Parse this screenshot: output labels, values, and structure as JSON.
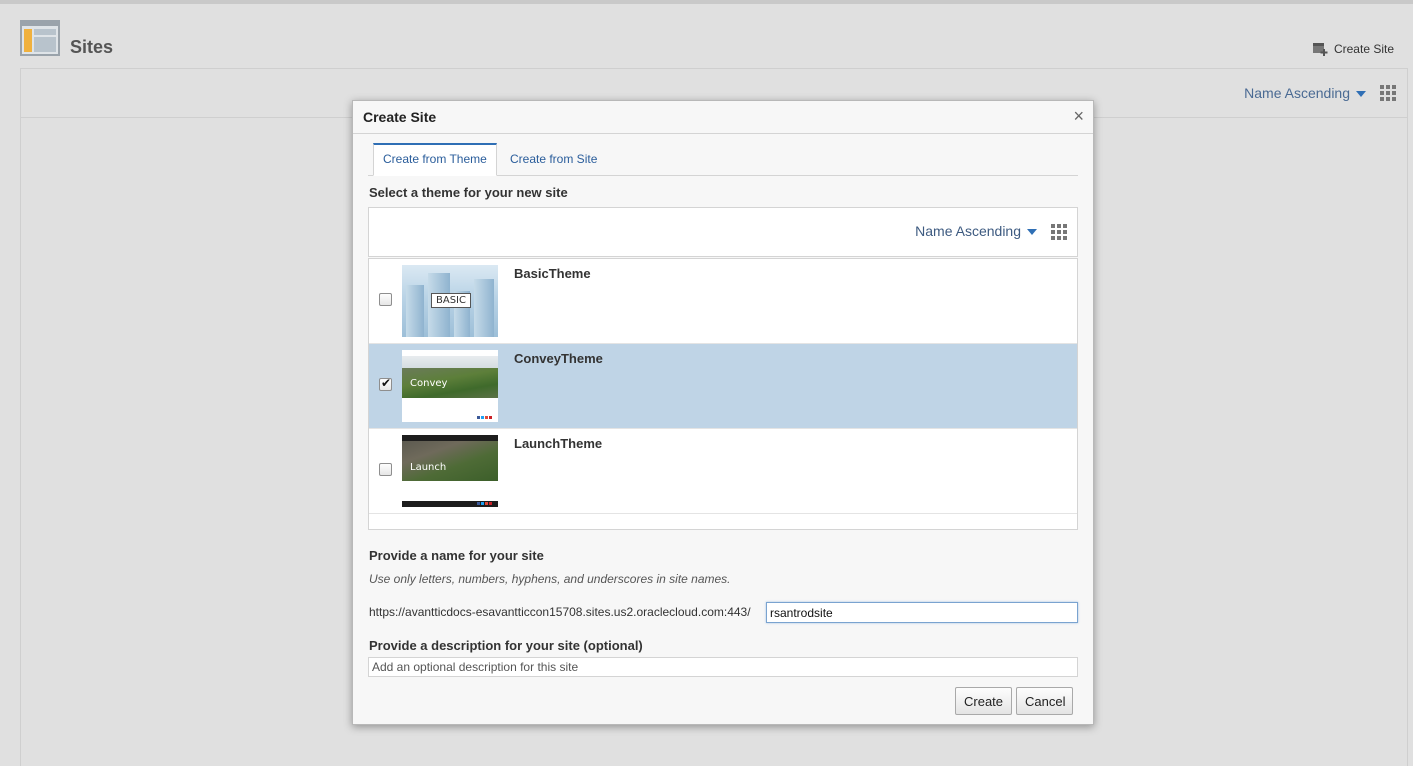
{
  "page": {
    "title": "Sites",
    "create_site_label": "Create Site",
    "sort_label": "Name Ascending"
  },
  "dialog": {
    "title": "Create Site",
    "close_glyph": "×",
    "tabs": [
      {
        "label": "Create from Theme",
        "active": true
      },
      {
        "label": "Create from Site",
        "active": false
      }
    ],
    "select_theme_label": "Select a theme for your new site",
    "sort_label": "Name Ascending",
    "themes": [
      {
        "name": "BasicTheme",
        "thumb_text": "BASIC",
        "checked": false
      },
      {
        "name": "ConveyTheme",
        "thumb_text": "Convey",
        "checked": true
      },
      {
        "name": "LaunchTheme",
        "thumb_text": "Launch",
        "checked": false
      }
    ],
    "name_label": "Provide a name for your site",
    "name_hint": "Use only letters, numbers, hyphens, and underscores in site names.",
    "url_prefix": "https://avantticdocs-esavantticcon15708.sites.us2.oraclecloud.com:443/",
    "site_name_value": "rsantrodsite",
    "description_label": "Provide a description for your site (optional)",
    "description_placeholder": "Add an optional description for this site",
    "description_value": "",
    "create_button": "Create",
    "cancel_button": "Cancel"
  },
  "colors": {
    "accent": "#2f6fb5",
    "selected_row": "#bfd4e6",
    "link": "#2a5d9b"
  }
}
